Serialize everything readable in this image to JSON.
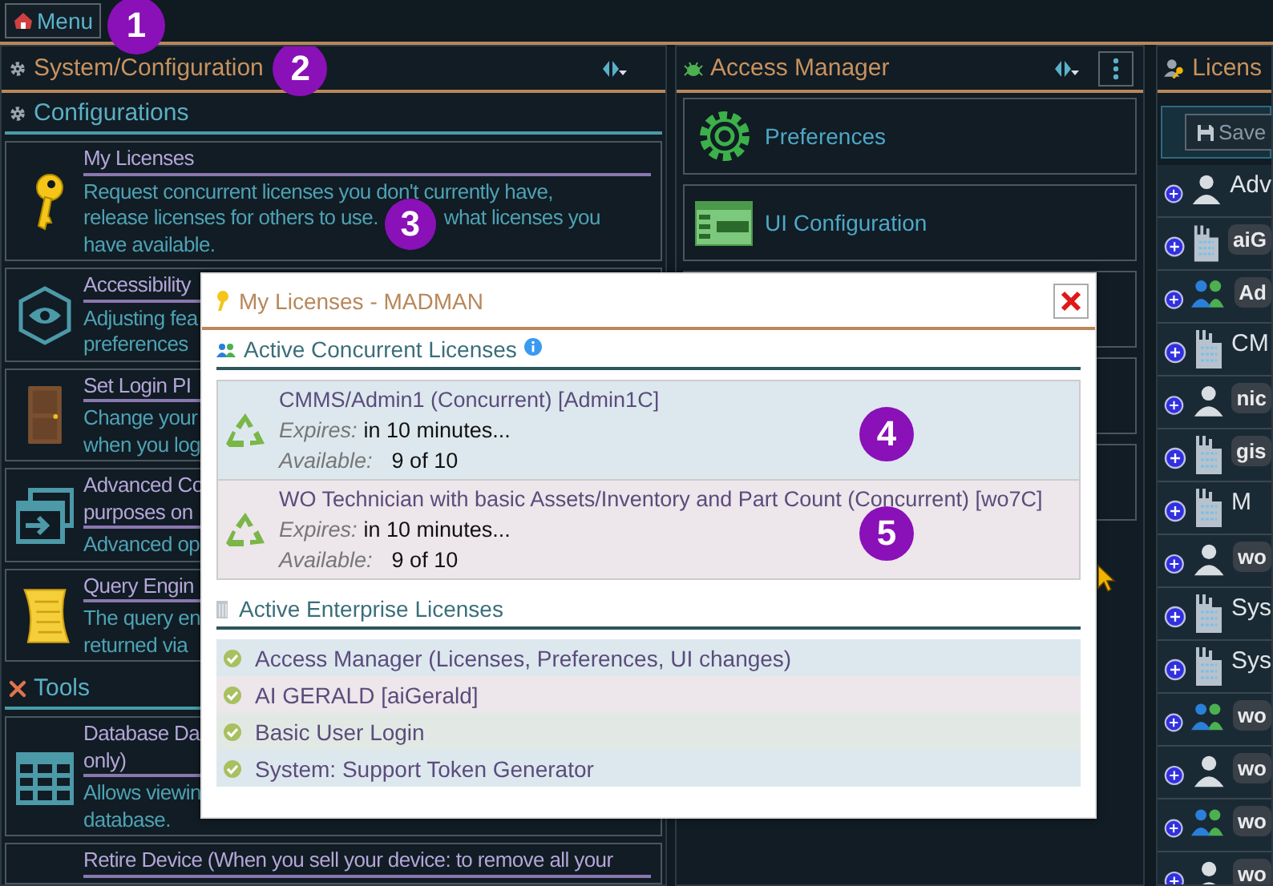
{
  "menu_button": {
    "label": "Menu",
    "marker": "1"
  },
  "config_panel": {
    "title": "System/Configuration",
    "marker": "2",
    "sections": [
      {
        "title": "Configurations",
        "items": [
          {
            "kind": "key",
            "title_lines": [
              "My Licenses"
            ],
            "desc_lines": [
              [
                "Request concurrent licenses you don't currently have,"
              ],
              [
                "release licenses for others to use.",
                "what licenses you"
              ],
              [
                "have available."
              ]
            ],
            "marker": "3"
          },
          {
            "kind": "eye",
            "title_lines": [
              "Accessibility"
            ],
            "desc_lines": [
              [
                "Adjusting fea"
              ],
              [
                "preferences"
              ]
            ]
          },
          {
            "kind": "door",
            "title_lines": [
              "Set Login PI"
            ],
            "desc_lines": [
              [
                "Change your"
              ],
              [
                "when you log"
              ]
            ]
          },
          {
            "kind": "window",
            "title_lines": [
              "Advanced Co",
              "purposes on"
            ],
            "desc_lines": [
              [
                "Advanced op"
              ]
            ]
          },
          {
            "kind": "scroll",
            "title_lines": [
              "Query Engin"
            ],
            "desc_lines": [
              [
                "The query en"
              ],
              [
                "returned via"
              ]
            ]
          }
        ]
      },
      {
        "title": "Tools",
        "items": [
          {
            "kind": "grid",
            "title_lines": [
              "Database Da",
              "only)"
            ],
            "desc_lines": [
              [
                "Allows viewin"
              ],
              [
                "database."
              ]
            ]
          },
          {
            "kind": "plain",
            "title_lines": [
              "Retire Device (When you sell your device: to remove all your"
            ]
          }
        ]
      }
    ]
  },
  "access_panel": {
    "title": "Access Manager",
    "items": [
      {
        "kind": "gear",
        "label": "Preferences"
      },
      {
        "kind": "ui",
        "label": "UI Configuration"
      },
      {
        "kind": "covered"
      },
      {
        "kind": "covered"
      },
      {
        "kind": "covered"
      }
    ]
  },
  "licenses_panel": {
    "title": "Licens",
    "save_label": "Save",
    "rows": [
      {
        "kind": "user",
        "badge": false,
        "text": "Adv"
      },
      {
        "kind": "building",
        "badge": true,
        "text": "aiG"
      },
      {
        "kind": "group",
        "badge": true,
        "text": "Ad"
      },
      {
        "kind": "building",
        "badge": false,
        "text": "CM"
      },
      {
        "kind": "user",
        "badge": true,
        "text": "nic"
      },
      {
        "kind": "building",
        "badge": true,
        "text": "gis"
      },
      {
        "kind": "building",
        "badge": false,
        "text": "M"
      },
      {
        "kind": "user",
        "badge": true,
        "text": "wo"
      },
      {
        "kind": "building",
        "badge": false,
        "text": "Sys"
      },
      {
        "kind": "building",
        "badge": false,
        "text": "Sys"
      },
      {
        "kind": "group",
        "badge": true,
        "text": "wo"
      },
      {
        "kind": "user",
        "badge": true,
        "text": "wo"
      },
      {
        "kind": "group",
        "badge": true,
        "text": "wo"
      },
      {
        "kind": "user",
        "badge": true,
        "text": "wo"
      }
    ]
  },
  "dialog": {
    "title": "My Licenses - MADMAN",
    "concurrent": {
      "title": "Active Concurrent Licenses",
      "licenses": [
        {
          "name": "CMMS/Admin1 (Concurrent) [Admin1C]",
          "expires_label": "Expires:",
          "expires": "in 10 minutes...",
          "available_label": "Available:",
          "available": "9 of 10",
          "marker": "4"
        },
        {
          "name": "WO Technician with basic Assets/Inventory and Part Count  (Concurrent) [wo7C]",
          "expires_label": "Expires:",
          "expires": "in 10 minutes...",
          "available_label": "Available:",
          "available": "9 of 10",
          "marker": "5"
        }
      ]
    },
    "enterprise": {
      "title": "Active Enterprise Licenses",
      "items": [
        "Access Manager (Licenses, Preferences, UI changes)",
        "AI GERALD [aiGerald]",
        "Basic User Login",
        "System: Support Token Generator"
      ]
    }
  }
}
